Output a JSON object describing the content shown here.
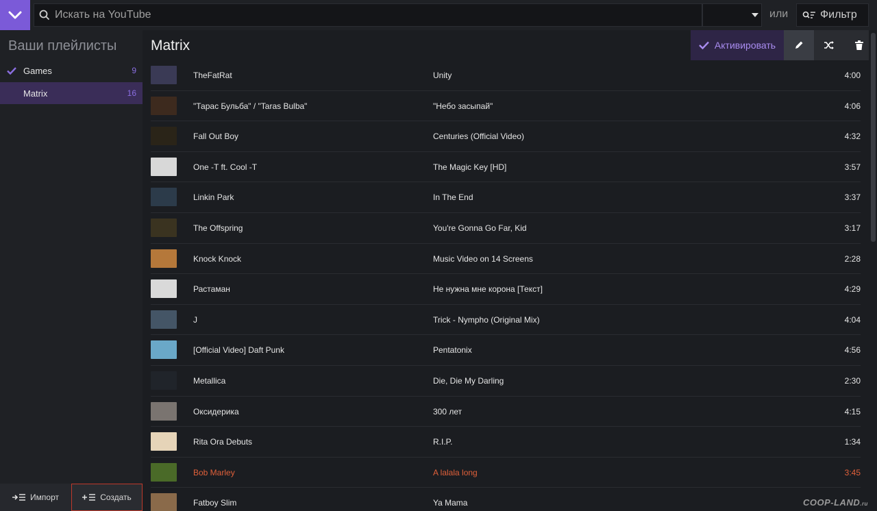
{
  "colors": {
    "accent": "#7b5ad8",
    "playing": "#e0603a",
    "count": "#8a6ee0"
  },
  "search": {
    "placeholder": "Искать на YouTube"
  },
  "header": {
    "or_label": "или",
    "filter_label": "Фильтр"
  },
  "sidebar": {
    "title": "Ваши плейлисты",
    "playlists": [
      {
        "name": "Games",
        "count": "9"
      },
      {
        "name": "Matrix",
        "count": "16"
      }
    ],
    "import_label": "Импорт",
    "create_label": "Создать"
  },
  "main": {
    "playlist_title": "Matrix",
    "activate_label": "Активировать"
  },
  "tracks": [
    {
      "artist": "TheFatRat",
      "title": "Unity",
      "duration": "4:00"
    },
    {
      "artist": "\"Тарас Бульба\" / \"Taras Bulba\"",
      "title": "\"Небо засыпай\"",
      "duration": "4:06"
    },
    {
      "artist": "Fall Out Boy",
      "title": "Centuries (Official Video)",
      "duration": "4:32"
    },
    {
      "artist": "One -T ft. Cool -T",
      "title": "The Magic Key [HD]",
      "duration": "3:57"
    },
    {
      "artist": "Linkin Park",
      "title": "In The End",
      "duration": "3:37"
    },
    {
      "artist": "The Offspring",
      "title": "You're Gonna Go Far, Kid",
      "duration": "3:17"
    },
    {
      "artist": "Knock Knock",
      "title": "Music Video on 14 Screens",
      "duration": "2:28"
    },
    {
      "artist": "Растаман",
      "title": "Не нужна мне корона [Текст]",
      "duration": "4:29"
    },
    {
      "artist": "J",
      "title": "Trick - Nympho (Original Mix)",
      "duration": "4:04"
    },
    {
      "artist": "[Official Video] Daft Punk",
      "title": "Pentatonix",
      "duration": "4:56"
    },
    {
      "artist": "Metallica",
      "title": "Die, Die My Darling",
      "duration": "2:30"
    },
    {
      "artist": "Оксидерика",
      "title": "300 лет",
      "duration": "4:15"
    },
    {
      "artist": "Rita Ora Debuts",
      "title": "R.I.P.",
      "duration": "1:34"
    },
    {
      "artist": "Bob Marley",
      "title": "A lalala long",
      "duration": "3:45",
      "playing": true
    },
    {
      "artist": "Fatboy Slim",
      "title": "Ya Mama",
      "duration": ""
    }
  ],
  "watermark": {
    "text": "COOP-LAND",
    "suffix": ".ru"
  }
}
